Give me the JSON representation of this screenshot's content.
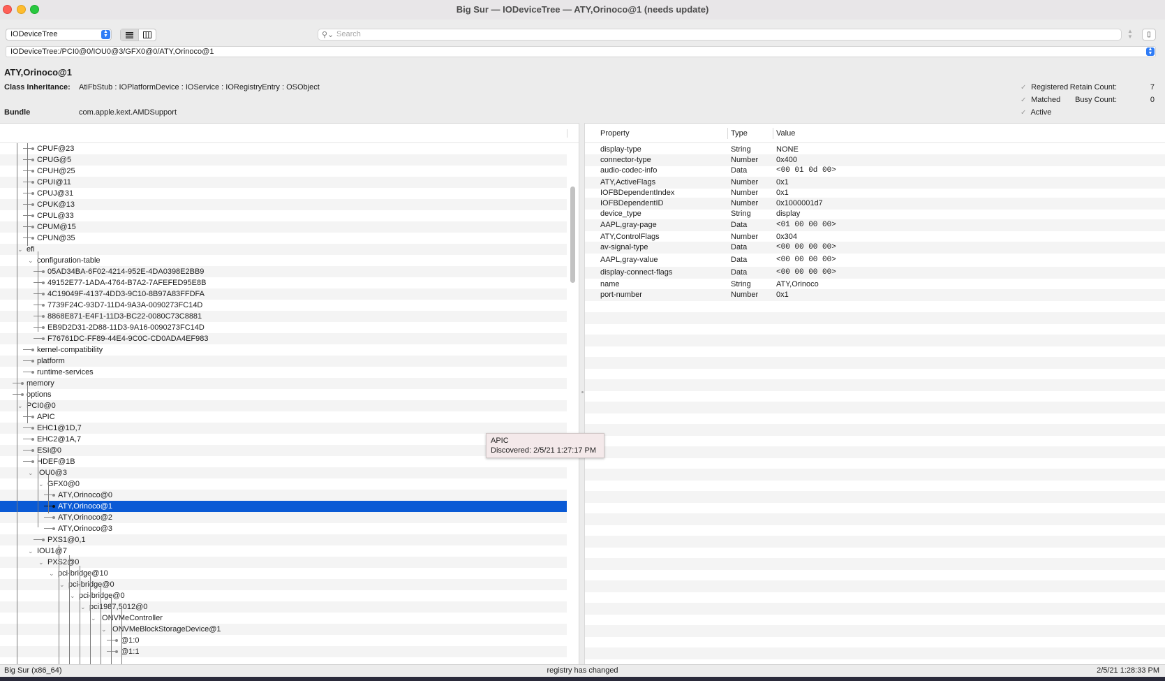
{
  "window": {
    "title": "Big Sur — IODeviceTree — ATY,Orinoco@1 (needs update)"
  },
  "toolbar": {
    "plane": "IODeviceTree",
    "view_list_icon": "list-view-icon",
    "view_columns_icon": "column-view-icon",
    "search_placeholder": "Search",
    "path": "IODeviceTree:/PCI0@0/IOU0@3/GFX0@0/ATY,Orinoco@1"
  },
  "info": {
    "name": "ATY,Orinoco@1",
    "class_label": "Class Inheritance:",
    "class_value": "AtiFbStub : IOPlatformDevice : IOService : IORegistryEntry : OSObject",
    "bundle_label": "Bundle",
    "bundle_value": "com.apple.kext.AMDSupport",
    "registered": "Registered",
    "matched": "Matched",
    "active": "Active",
    "retain_label": "Retain Count:",
    "retain_value": "7",
    "busy_label": "Busy Count:",
    "busy_value": "0"
  },
  "tree": [
    {
      "label": "CPUF@23",
      "level": 3,
      "expanded": null
    },
    {
      "label": "CPUG@5",
      "level": 3,
      "expanded": null
    },
    {
      "label": "CPUH@25",
      "level": 3,
      "expanded": null
    },
    {
      "label": "CPUI@11",
      "level": 3,
      "expanded": null
    },
    {
      "label": "CPUJ@31",
      "level": 3,
      "expanded": null
    },
    {
      "label": "CPUK@13",
      "level": 3,
      "expanded": null
    },
    {
      "label": "CPUL@33",
      "level": 3,
      "expanded": null
    },
    {
      "label": "CPUM@15",
      "level": 3,
      "expanded": null
    },
    {
      "label": "CPUN@35",
      "level": 3,
      "expanded": null
    },
    {
      "label": "efi",
      "level": 2,
      "expanded": true
    },
    {
      "label": "configuration-table",
      "level": 3,
      "expanded": true
    },
    {
      "label": "05AD34BA-6F02-4214-952E-4DA0398E2BB9",
      "level": 4,
      "expanded": null
    },
    {
      "label": "49152E77-1ADA-4764-B7A2-7AFEFED95E8B",
      "level": 4,
      "expanded": null
    },
    {
      "label": "4C19049F-4137-4DD3-9C10-8B97A83FFDFA",
      "level": 4,
      "expanded": null
    },
    {
      "label": "7739F24C-93D7-11D4-9A3A-0090273FC14D",
      "level": 4,
      "expanded": null
    },
    {
      "label": "8868E871-E4F1-11D3-BC22-0080C73C8881",
      "level": 4,
      "expanded": null
    },
    {
      "label": "EB9D2D31-2D88-11D3-9A16-0090273FC14D",
      "level": 4,
      "expanded": null
    },
    {
      "label": "F76761DC-FF89-44E4-9C0C-CD0ADA4EF983",
      "level": 4,
      "expanded": null
    },
    {
      "label": "kernel-compatibility",
      "level": 3,
      "expanded": null
    },
    {
      "label": "platform",
      "level": 3,
      "expanded": null
    },
    {
      "label": "runtime-services",
      "level": 3,
      "expanded": null
    },
    {
      "label": "memory",
      "level": 2,
      "expanded": null
    },
    {
      "label": "options",
      "level": 2,
      "expanded": null
    },
    {
      "label": "PCI0@0",
      "level": 2,
      "expanded": true
    },
    {
      "label": "APIC",
      "level": 3,
      "expanded": null
    },
    {
      "label": "EHC1@1D,7",
      "level": 3,
      "expanded": null
    },
    {
      "label": "EHC2@1A,7",
      "level": 3,
      "expanded": null
    },
    {
      "label": "ESI@0",
      "level": 3,
      "expanded": null
    },
    {
      "label": "HDEF@1B",
      "level": 3,
      "expanded": null
    },
    {
      "label": "IOU0@3",
      "level": 3,
      "expanded": true
    },
    {
      "label": "GFX0@0",
      "level": 4,
      "expanded": true
    },
    {
      "label": "ATY,Orinoco@0",
      "level": 5,
      "expanded": null
    },
    {
      "label": "ATY,Orinoco@1",
      "level": 5,
      "expanded": null,
      "selected": true
    },
    {
      "label": "ATY,Orinoco@2",
      "level": 5,
      "expanded": null
    },
    {
      "label": "ATY,Orinoco@3",
      "level": 5,
      "expanded": null
    },
    {
      "label": "PXS1@0,1",
      "level": 4,
      "expanded": null
    },
    {
      "label": "IOU1@7",
      "level": 3,
      "expanded": true
    },
    {
      "label": "PXS2@0",
      "level": 4,
      "expanded": true
    },
    {
      "label": "pci-bridge@10",
      "level": 5,
      "expanded": true
    },
    {
      "label": "pci-bridge@0",
      "level": 6,
      "expanded": true
    },
    {
      "label": "pci-bridge@0",
      "level": 7,
      "expanded": true
    },
    {
      "label": "pci1987,5012@0",
      "level": 8,
      "expanded": true
    },
    {
      "label": "IONVMeController",
      "level": 9,
      "expanded": true
    },
    {
      "label": "IONVMeBlockStorageDevice@1",
      "level": 10,
      "expanded": true
    },
    {
      "label": "@1:0",
      "level": 11,
      "expanded": null
    },
    {
      "label": "@1:1",
      "level": 11,
      "expanded": null
    }
  ],
  "properties": {
    "headers": [
      "Property",
      "Type",
      "Value"
    ],
    "rows": [
      {
        "property": "display-type",
        "type": "String",
        "value": "NONE"
      },
      {
        "property": "connector-type",
        "type": "Number",
        "value": "0x400"
      },
      {
        "property": "audio-codec-info",
        "type": "Data",
        "value": "<00 01 0d 00>"
      },
      {
        "property": "ATY,ActiveFlags",
        "type": "Number",
        "value": "0x1"
      },
      {
        "property": "IOFBDependentIndex",
        "type": "Number",
        "value": "0x1"
      },
      {
        "property": "IOFBDependentID",
        "type": "Number",
        "value": "0x1000001d7"
      },
      {
        "property": "device_type",
        "type": "String",
        "value": "display"
      },
      {
        "property": "AAPL,gray-page",
        "type": "Data",
        "value": "<01 00 00 00>"
      },
      {
        "property": "ATY,ControlFlags",
        "type": "Number",
        "value": "0x304"
      },
      {
        "property": "av-signal-type",
        "type": "Data",
        "value": "<00 00 00 00>"
      },
      {
        "property": "AAPL,gray-value",
        "type": "Data",
        "value": "<00 00 00 00>"
      },
      {
        "property": "display-connect-flags",
        "type": "Data",
        "value": "<00 00 00 00>"
      },
      {
        "property": "name",
        "type": "String",
        "value": "ATY,Orinoco"
      },
      {
        "property": "port-number",
        "type": "Number",
        "value": "0x1"
      }
    ]
  },
  "tooltip": {
    "title": "APIC",
    "text": "Discovered: 2/5/21 1:27:17 PM"
  },
  "status": {
    "left": "Big Sur (x86_64)",
    "middle": "registry has changed",
    "right": "2/5/21 1:28:33 PM"
  },
  "colors": {
    "selection": "#0a5ad5",
    "accent": "#2f7cf6"
  }
}
